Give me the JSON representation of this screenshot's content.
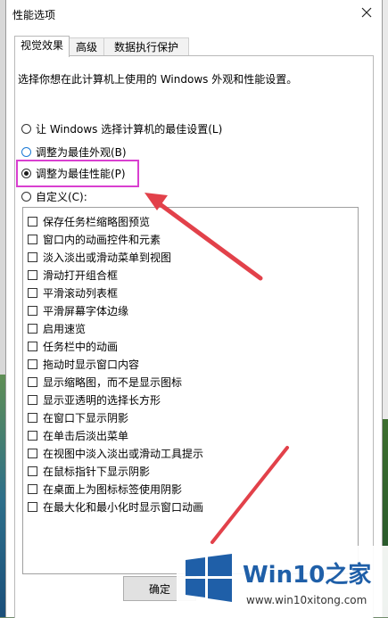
{
  "window": {
    "title": "性能选项"
  },
  "tabs": [
    {
      "label": "视觉效果"
    },
    {
      "label": "高级"
    },
    {
      "label": "数据执行保护"
    }
  ],
  "description": "选择你想在此计算机上使用的 Windows 外观和性能设置。",
  "radios": [
    {
      "label": "让 Windows 选择计算机的最佳设置(L)",
      "checked": false
    },
    {
      "label": "调整为最佳外观(B)",
      "checked": false
    },
    {
      "label": "调整为最佳性能(P)",
      "checked": true
    },
    {
      "label": "自定义(C):",
      "checked": false
    }
  ],
  "options": [
    "保存任务栏缩略图预览",
    "窗口内的动画控件和元素",
    "淡入淡出或滑动菜单到视图",
    "滑动打开组合框",
    "平滑滚动列表框",
    "平滑屏幕字体边缘",
    "启用速览",
    "任务栏中的动画",
    "拖动时显示窗口内容",
    "显示缩略图，而不是显示图标",
    "显示亚透明的选择长方形",
    "在窗口下显示阴影",
    "在单击后淡出菜单",
    "在视图中淡入淡出或滑动工具提示",
    "在鼠标指针下显示阴影",
    "在桌面上为图标标签使用阴影",
    "在最大化和最小化时显示窗口动画"
  ],
  "buttons": {
    "ok": "确定"
  },
  "watermark": {
    "title": "Win10之家",
    "url": "www.win10xitong.com"
  },
  "colors": {
    "highlight": "#d93fd0",
    "arrow": "#e2414a",
    "brand": "#1f5fa8"
  }
}
